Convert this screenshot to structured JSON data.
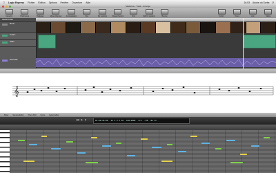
{
  "menubar": {
    "app": "Logic Express",
    "menus": [
      "Fichier",
      "Édition",
      "Options",
      "Fenêtre",
      "Ouverture",
      "Aide"
    ],
    "clock": "16:53",
    "user": "Adobe du Sorbe"
  },
  "window": {
    "title": "Madonna - Track - Arrange"
  },
  "toolbar": [
    "Inspector",
    "Préférences",
    "Réglages",
    "Glisser-Déposer",
    "Automatisation",
    "Flex",
    "Set Locators",
    "Repeat Section",
    "Crop",
    "Split by Locators",
    "Bounce",
    "Colors",
    "Notes",
    "Lists",
    "Media"
  ],
  "tracks": [
    {
      "name": "Global Tracks"
    },
    {
      "name": "Movie"
    },
    {
      "name": "Track 1"
    },
    {
      "name": "Audio"
    },
    {
      "name": "Ensemble"
    }
  ],
  "bottom_tabs": [
    "Mixer",
    "Sample Editor",
    "Piano Roll",
    "Score",
    "Hyper Editor"
  ],
  "transport": {
    "position": "12 1 4 1 18",
    "time": "01:00:16:06",
    "tempo": "120.0000",
    "signature": "4/4",
    "division": "/16",
    "key": "No In"
  },
  "colors": {
    "region_green": "#4aa680",
    "audio_purple": "#6a5ea8",
    "note_blue": "#5fb4e6",
    "note_green": "#7fd24a",
    "note_yellow": "#e6d24a"
  }
}
